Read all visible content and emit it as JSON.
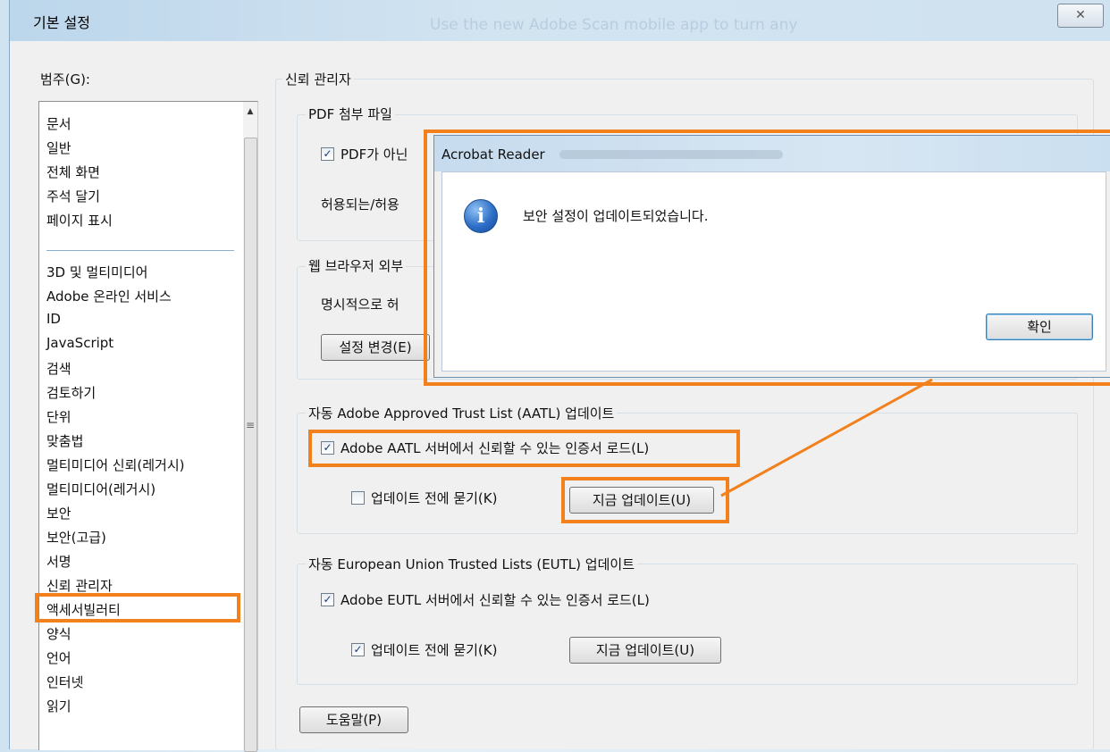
{
  "window": {
    "title": "기본 설정",
    "background_text": "Use the new Adobe Scan mobile app to turn any",
    "close_icon": "close-icon"
  },
  "sidebar": {
    "label": "범주(G):",
    "items": [
      "문서",
      "일반",
      "전체 화면",
      "주석 달기",
      "페이지 표시",
      "3D 및 멀티미디어",
      "Adobe 온라인 서비스",
      "ID",
      "JavaScript",
      "검색",
      "검토하기",
      "단위",
      "맞춤법",
      "멀티미디어 신뢰(레거시)",
      "멀티미디어(레거시)",
      "보안",
      "보안(고급)",
      "서명",
      "신뢰 관리자",
      "액세서빌러티",
      "양식",
      "언어",
      "인터넷",
      "읽기"
    ],
    "selected": "신뢰 관리자"
  },
  "main": {
    "section_title": "신뢰 관리자",
    "pdf_attach": {
      "title": "PDF 첨부 파일",
      "checkbox_label": "PDF가 아닌",
      "allowed_label": "허용되는/허용"
    },
    "web": {
      "title": "웹 브라우저 외부",
      "explicit_label": "명시적으로 허",
      "settings_button": "설정 변경(E)"
    },
    "aatl": {
      "title": "자동 Adobe Approved Trust List (AATL) 업데이트",
      "load_label": "Adobe AATL 서버에서 신뢰할 수 있는 인증서 로드(L)",
      "load_checked": true,
      "ask_label": "업데이트 전에 묻기(K)",
      "ask_checked": false,
      "update_button": "지금 업데이트(U)"
    },
    "eutl": {
      "title": "자동 European Union Trusted Lists (EUTL) 업데이트",
      "load_label": "Adobe EUTL 서버에서 신뢰할 수 있는 인증서 로드(L)",
      "load_checked": true,
      "ask_label": "업데이트 전에 묻기(K)",
      "ask_checked": true,
      "update_button": "지금 업데이트(U)"
    },
    "help_button": "도움말(P)"
  },
  "dialog": {
    "title": "Acrobat Reader",
    "message": "보안 설정이 업데이트되었습니다.",
    "ok_button": "확인",
    "icon": "info-icon"
  },
  "checkmark": "✓",
  "highlight_color": "#f2801c"
}
